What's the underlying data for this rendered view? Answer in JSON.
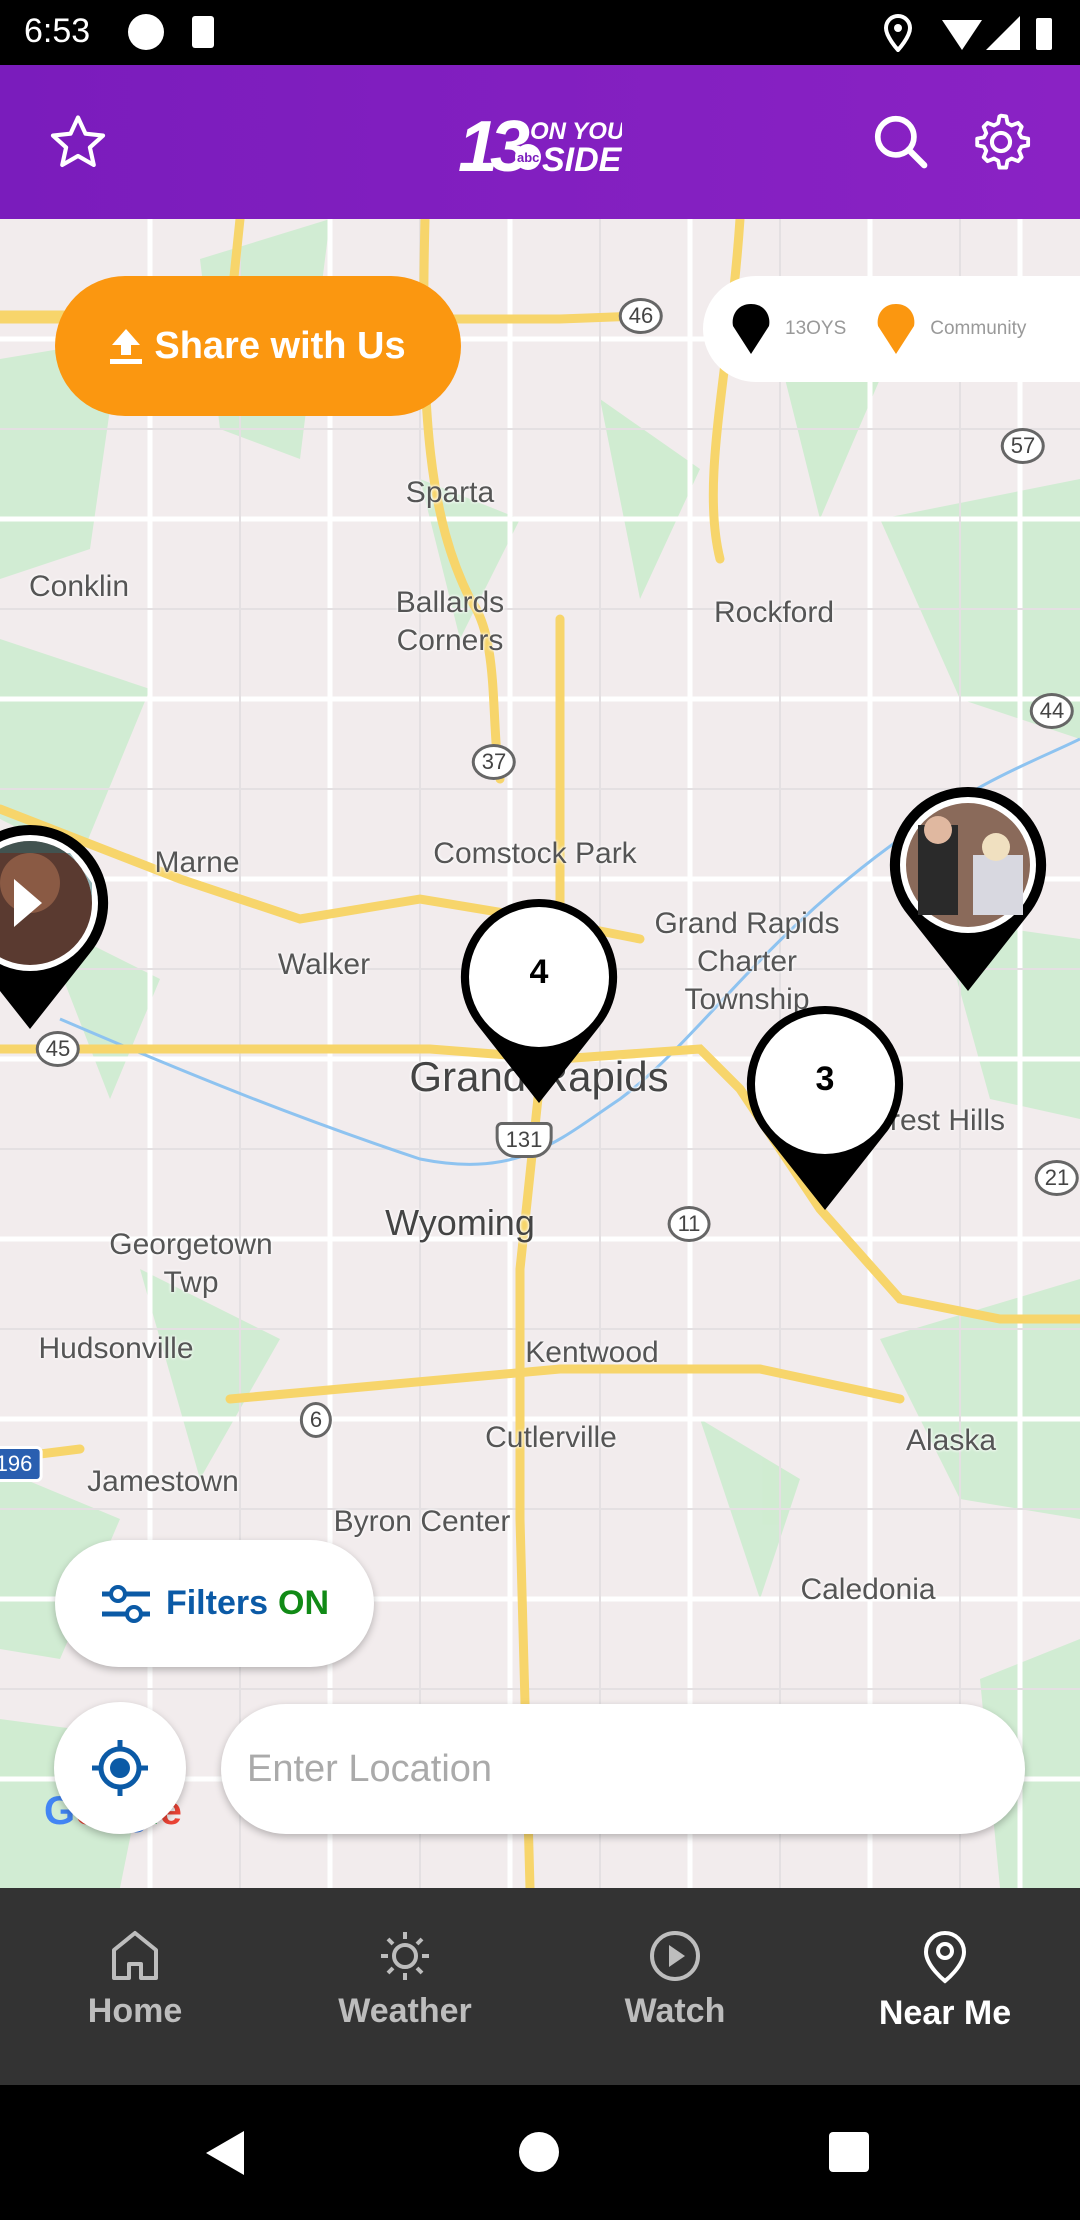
{
  "status_bar": {
    "time": "6:53"
  },
  "header": {
    "logo_text": "13 ON YOUR SIDE abc",
    "icons": [
      "star-icon",
      "search-icon",
      "gear-icon"
    ]
  },
  "map": {
    "labels": [
      "Sparta",
      "Conklin",
      "Ballards Corners",
      "Rockford",
      "Marne",
      "Comstock Park",
      "Walker",
      "Grand Rapids Charter Township",
      "Grand Rapids",
      "Forest Hills",
      "Wyoming",
      "Georgetown Twp",
      "Hudsonville",
      "Kentwood",
      "Cutlerville",
      "Alaska",
      "Jamestown",
      "Byron Center",
      "Caledonia"
    ],
    "shields": [
      "46",
      "57",
      "44",
      "37",
      "45",
      "131",
      "11",
      "21",
      "6",
      "196"
    ],
    "clusters": [
      {
        "count": "4"
      },
      {
        "count": "3"
      }
    ],
    "attribution": "Google"
  },
  "share_button": {
    "label": "Share with Us"
  },
  "legend": {
    "items": [
      {
        "label": "13OYS",
        "color": "#000000"
      },
      {
        "label": "Community",
        "color": "#fb9710"
      }
    ]
  },
  "filters": {
    "label": "Filters",
    "state": "ON",
    "label_color": "#0b5aa6",
    "state_color": "#118a16"
  },
  "location_input": {
    "placeholder": "Enter Location",
    "value": ""
  },
  "bottom_nav": {
    "items": [
      {
        "label": "Home",
        "icon": "home-icon"
      },
      {
        "label": "Weather",
        "icon": "sun-icon"
      },
      {
        "label": "Watch",
        "icon": "play-circle-icon"
      },
      {
        "label": "Near Me",
        "icon": "location-pin-icon",
        "active": true
      }
    ]
  },
  "colors": {
    "header": "#7a1cbc",
    "accent": "#fb9710",
    "nav": "#333333"
  }
}
